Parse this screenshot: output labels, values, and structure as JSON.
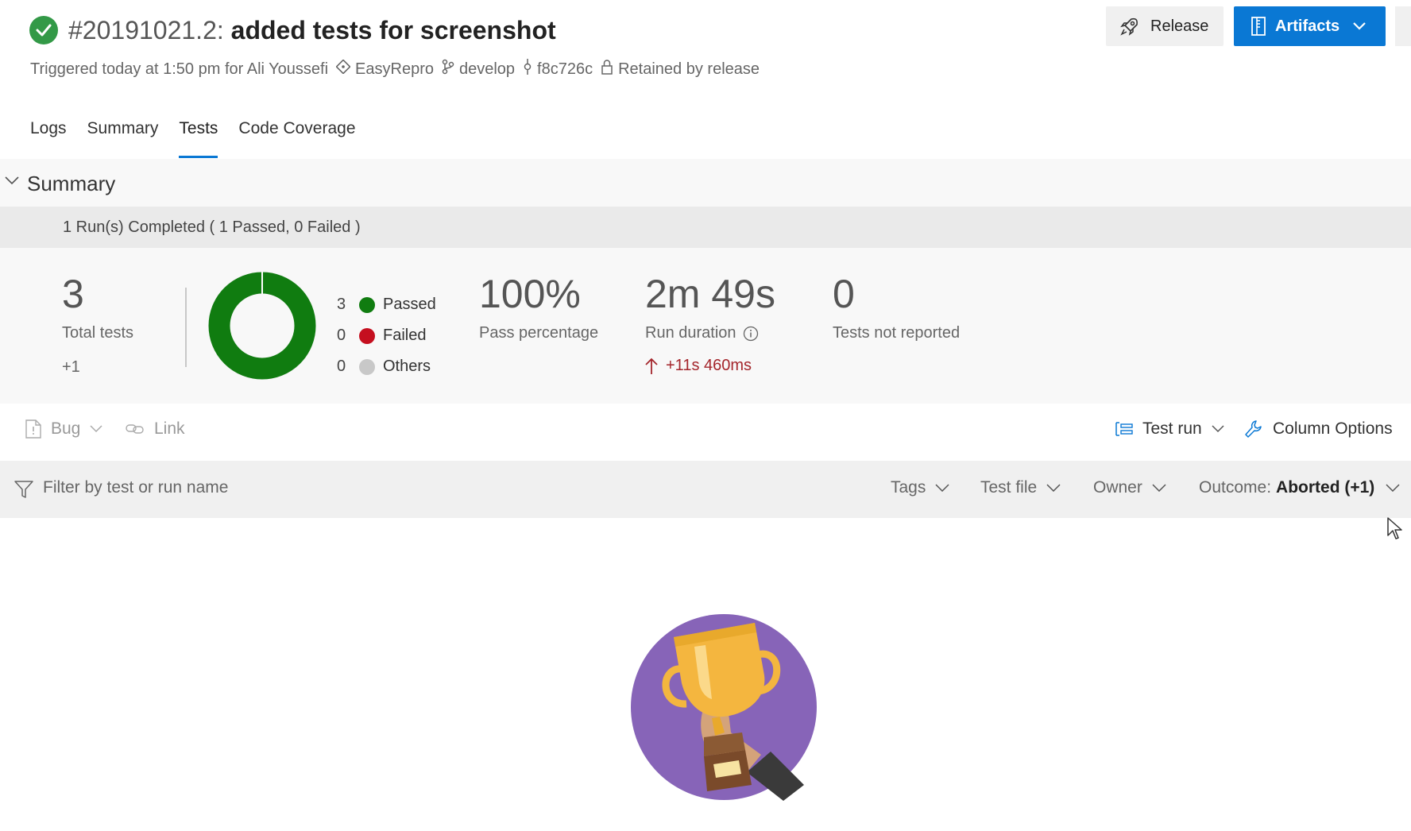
{
  "header": {
    "build_number": "#20191021.2:",
    "build_message": "added tests for screenshot",
    "triggered": "Triggered today at 1:50 pm for Ali Youssefi",
    "repo": "EasyRepro",
    "branch": "develop",
    "commit": "f8c726c",
    "retention": "Retained by release",
    "release_label": "Release",
    "artifacts_label": "Artifacts"
  },
  "tabs": [
    {
      "label": "Logs"
    },
    {
      "label": "Summary"
    },
    {
      "label": "Tests",
      "active": true
    },
    {
      "label": "Code Coverage"
    }
  ],
  "summary": {
    "title": "Summary",
    "runs_completed": "1 Run(s) Completed ( 1 Passed, 0 Failed )",
    "total_tests": "3",
    "total_label": "Total tests",
    "total_delta": "+1",
    "legend": [
      {
        "count": "3",
        "name": "Passed",
        "color": "#107c10"
      },
      {
        "count": "0",
        "name": "Failed",
        "color": "#c50f1f"
      },
      {
        "count": "0",
        "name": "Others",
        "color": "#c8c8c8"
      }
    ],
    "pass_percentage": "100%",
    "pass_label": "Pass percentage",
    "run_duration": "2m 49s",
    "duration_label": "Run duration",
    "duration_delta": "+11s 460ms",
    "not_reported": "0",
    "not_reported_label": "Tests not reported",
    "pass_fraction": 1.0
  },
  "toolbar": {
    "bug_label": "Bug",
    "link_label": "Link",
    "test_run_label": "Test run",
    "column_options_label": "Column Options"
  },
  "filter": {
    "placeholder": "Filter by test or run name",
    "tags_label": "Tags",
    "test_file_label": "Test file",
    "owner_label": "Owner",
    "outcome_prefix": "Outcome:",
    "outcome_value": "Aborted (+1)"
  },
  "colors": {
    "accent": "#0a78d4",
    "success": "#339947",
    "passed": "#107c10",
    "failed": "#c50f1f",
    "delta_bad": "#a4262c"
  }
}
